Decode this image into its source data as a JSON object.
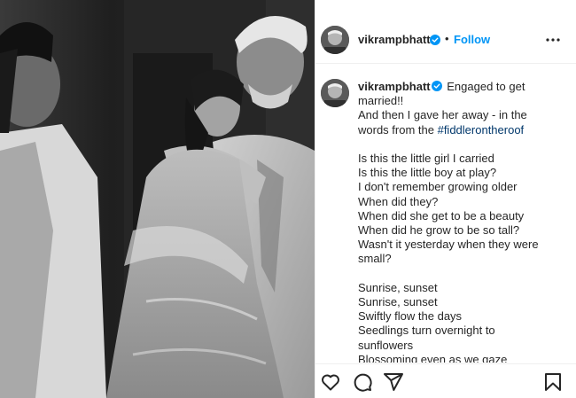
{
  "post": {
    "username": "vikrampbhatt",
    "follow_label": "Follow",
    "separator": "•"
  },
  "caption": {
    "username": "vikrampbhatt",
    "first": "Engaged to get married!!",
    "line2": "And then I gave her away - in the",
    "line3_text": "words from the ",
    "hashtag": "#fiddlerontheroof",
    "verse1": [
      "Is this the little girl I carried",
      "Is this the little boy at play?",
      "I don't remember growing older",
      "When did they?",
      "When did she get to be a beauty",
      "When did he grow to be so tall?",
      "Wasn't it yesterday when they were",
      "small?"
    ],
    "verse2": [
      "Sunrise, sunset",
      "Sunrise, sunset",
      "Swiftly flow the days",
      "Seedlings turn overnight to",
      "sunflowers",
      "Blossoming even as we gaze"
    ]
  },
  "icons": {
    "verified": "verified-badge-icon",
    "more": "more-options-icon",
    "like": "heart-icon",
    "comment": "comment-icon",
    "share": "share-icon",
    "save": "bookmark-icon"
  },
  "colors": {
    "accent": "#0095f6",
    "hashtag": "#00376b",
    "text": "#262626",
    "border": "#efefef"
  }
}
